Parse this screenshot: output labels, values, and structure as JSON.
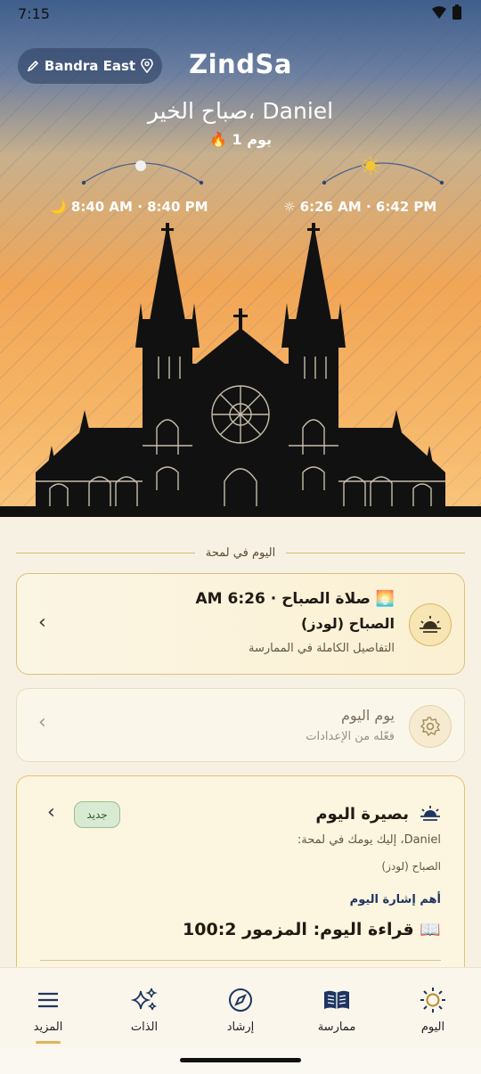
{
  "status": {
    "time": "7:15"
  },
  "header": {
    "location_label": "Bandra East",
    "brand": "ZindSa",
    "greeting": "صباح الخير، Daniel",
    "streak": "🔥 1 يوم"
  },
  "sky": {
    "moon_times": "🌙 8:40 AM · 8:40 PM",
    "sun_times": "☼ 6:26 AM · 6:42 PM"
  },
  "section_title": "اليوم في لمحة",
  "cards": {
    "prayer": {
      "title": "🌅 صلاة الصباح · 6:26 AM",
      "subtitle": "الصباح (لودز)",
      "note": "التفاصيل الكاملة في الممارسة"
    },
    "day": {
      "title": "يوم اليوم",
      "subtitle": "فعّله من الإعدادات"
    },
    "insight": {
      "title": "بصيرة اليوم",
      "badge": "جديد",
      "line1": "Daniel، إليك يومك في لمحة:",
      "line2": "الصباح (لودز)",
      "highlight_label": "أهم إشارة اليوم",
      "reading": "📖 قراءة اليوم: المزمور 100:2"
    }
  },
  "tabs": [
    {
      "label": "اليوم",
      "icon": "sun-icon"
    },
    {
      "label": "ممارسة",
      "icon": "book-icon"
    },
    {
      "label": "إرشاد",
      "icon": "compass-icon"
    },
    {
      "label": "الذات",
      "icon": "sparkles-icon"
    },
    {
      "label": "المزيد",
      "icon": "menu-icon"
    }
  ],
  "colors": {
    "accent_gold": "#c9a34a",
    "sky_top": "#3f5e8c",
    "sky_bottom": "#f9c57c"
  }
}
